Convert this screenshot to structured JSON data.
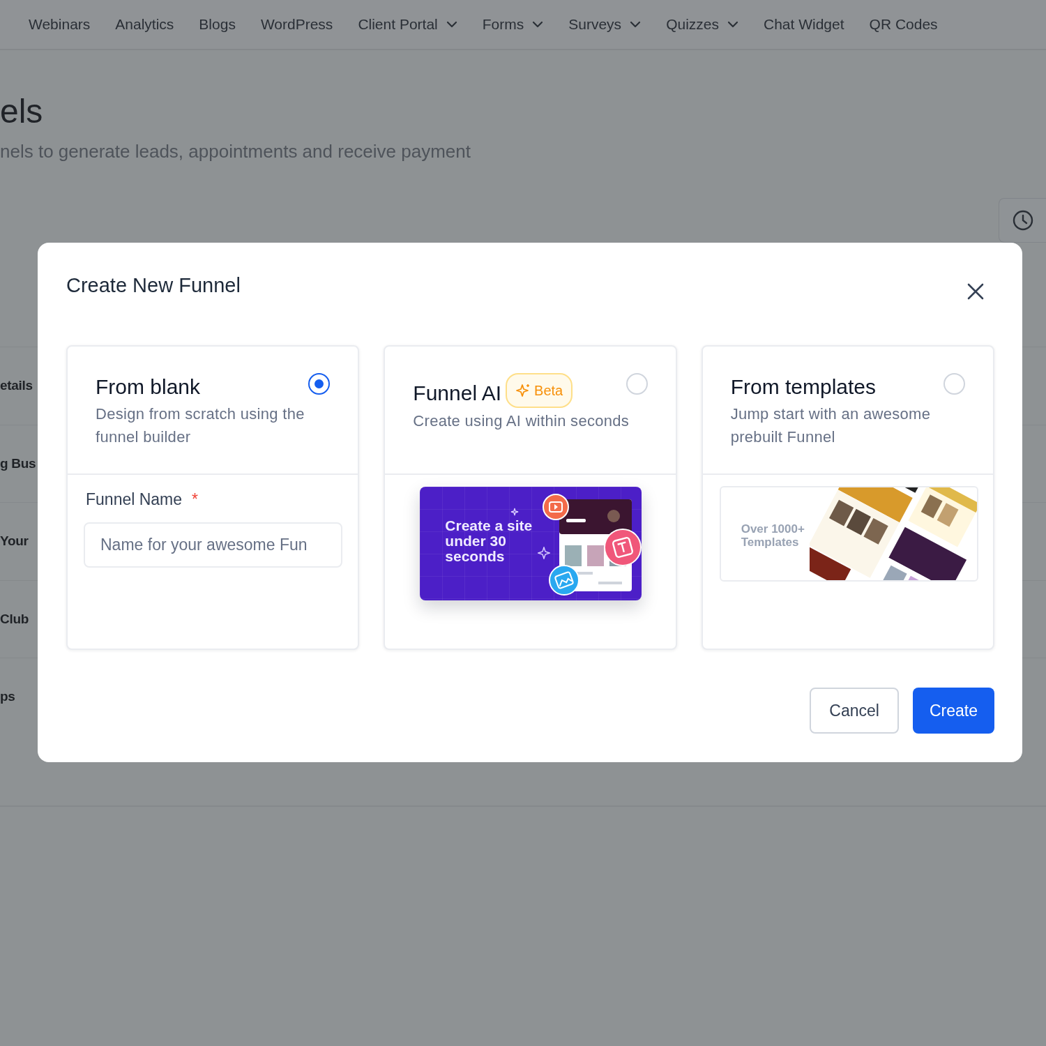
{
  "nav": {
    "items": [
      {
        "label": "Webinars",
        "dropdown": false
      },
      {
        "label": "Analytics",
        "dropdown": false
      },
      {
        "label": "Blogs",
        "dropdown": false
      },
      {
        "label": "WordPress",
        "dropdown": false
      },
      {
        "label": "Client Portal",
        "dropdown": true
      },
      {
        "label": "Forms",
        "dropdown": true
      },
      {
        "label": "Surveys",
        "dropdown": true
      },
      {
        "label": "Quizzes",
        "dropdown": true
      },
      {
        "label": "Chat Widget",
        "dropdown": false
      },
      {
        "label": "QR Codes",
        "dropdown": false
      }
    ]
  },
  "page": {
    "title": "els",
    "subtitle": "nels to generate leads, appointments and receive payment",
    "sidebar_items": [
      "etails",
      "g Bus",
      "Your",
      "Club",
      "ps"
    ]
  },
  "modal": {
    "title": "Create New Funnel",
    "options": [
      {
        "kind": "blank",
        "title": "From blank",
        "description": "Design from scratch using the funnel builder",
        "selected": true,
        "field": {
          "label": "Funnel Name",
          "required_mark": "*",
          "placeholder": "Name for your awesome Fun"
        }
      },
      {
        "kind": "ai",
        "title": "Funnel AI",
        "badge": "Beta",
        "description": "Create using AI within seconds",
        "selected": false,
        "preview_text": "Create a site under 30 seconds"
      },
      {
        "kind": "templates",
        "title": "From templates",
        "description": "Jump start with an awesome prebuilt Funnel",
        "selected": false,
        "preview_text": "Over 1000+ Templates"
      }
    ],
    "buttons": [
      {
        "label": "Cancel",
        "primary": false
      },
      {
        "label": "Create",
        "primary": true
      }
    ]
  }
}
